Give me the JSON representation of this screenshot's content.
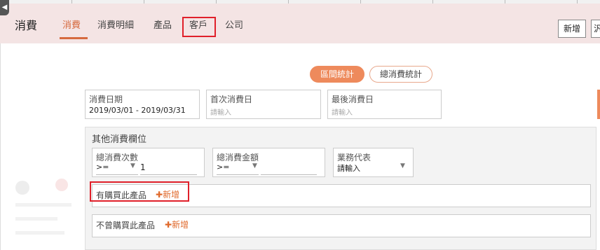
{
  "header": {
    "title": "消費",
    "tabs": [
      {
        "label": "消費",
        "active": true
      },
      {
        "label": "消費明細",
        "active": false
      },
      {
        "label": "產品",
        "active": false
      },
      {
        "label": "客戶",
        "active": false,
        "highlighted": true
      },
      {
        "label": "公司",
        "active": false
      }
    ],
    "new_button": "新增",
    "cut_button": "汎"
  },
  "collapse_icon": "chevron-left-icon",
  "stat_tabs": {
    "range": "區間統計",
    "total": "總消費統計"
  },
  "date_filters": {
    "consume_date": {
      "label": "消費日期",
      "value": "2019/03/01 - 2019/03/31"
    },
    "first_date": {
      "label": "首次消費日",
      "placeholder": "請輸入"
    },
    "last_date": {
      "label": "最後消費日",
      "placeholder": "請輸入"
    }
  },
  "other": {
    "title": "其他消費欄位",
    "count": {
      "label": "總消費次數",
      "operator": ">=",
      "value": "1"
    },
    "amount": {
      "label": "總消費金額",
      "operator": ">=",
      "value": ""
    },
    "rep": {
      "label": "業務代表",
      "value": "請輸入"
    },
    "bought": {
      "label": "有購買此產品",
      "add": "新增"
    },
    "not_bought": {
      "label": "不曾購買此產品",
      "add": "新增"
    }
  },
  "colors": {
    "accent": "#ee8a5c",
    "highlight": "#e0202a",
    "header_bg": "#f4e4e4"
  }
}
